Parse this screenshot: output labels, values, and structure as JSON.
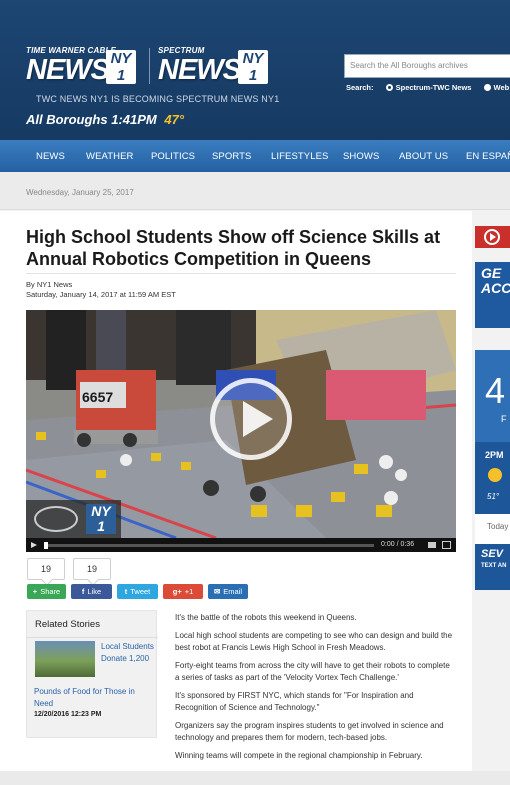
{
  "header": {
    "logo1": {
      "top": "TIME WARNER CABLE",
      "big": "NEWS",
      "badge": [
        "NY",
        "1"
      ]
    },
    "logo2": {
      "top": "SPECTRUM",
      "big": "NEWS",
      "badge": [
        "NY",
        "1"
      ]
    },
    "becoming": "TWC NEWS NY1 IS BECOMING SPECTRUM NEWS NY1",
    "borough": "All Boroughs",
    "time": "1:41PM",
    "temp": "47°",
    "search_placeholder": "Search the All Boroughs archives",
    "search_label": "Search:",
    "search_opt1": "Spectrum-TWC News",
    "search_opt2": "Web"
  },
  "nav": [
    "NEWS",
    "WEATHER",
    "POLITICS",
    "SPORTS",
    "LIFESTYLES",
    "SHOWS",
    "ABOUT US",
    "EN ESPAÑOL"
  ],
  "date": "Wednesday, January 25, 2017",
  "article": {
    "title": "High School Students Show off Science Skills at Annual Robotics Competition in Queens",
    "byline": "By NY1 News",
    "dateline": "Saturday, January 14, 2017 at 11:59 AM EST",
    "robot_number": "6657",
    "video_time": "0:00 / 0:36",
    "paragraphs": [
      "It's the battle of the robots this weekend in Queens.",
      "Local high school students are competing to see who can design and build the best robot at Francis Lewis High School in Fresh Meadows.",
      "Forty-eight  teams from across the city will have to get their robots to complete a series of tasks as part of the 'Velocity Vortex Tech Challenge.'",
      "It's sponsored by FIRST NYC, which stands for \"For Inspiration and Recognition of Science and Technology.\"",
      "Organizers say the program inspires students to get involved in science and technology and prepares them for modern, tech-based jobs.",
      "Winning teams will compete in the regional championship in February."
    ]
  },
  "share": {
    "count1": "19",
    "count2": "19",
    "buttons": [
      {
        "icon": "+",
        "label": "Share",
        "color": "#3aa757"
      },
      {
        "icon": "f",
        "label": "Like",
        "color": "#3b5998"
      },
      {
        "icon": "t",
        "label": "Tweet",
        "color": "#2ea7e0"
      },
      {
        "icon": "g+",
        "label": "+1",
        "color": "#dc4a38"
      },
      {
        "icon": "✉",
        "label": "Email",
        "color": "#2a6fb3"
      }
    ]
  },
  "related": {
    "heading": "Related Stories",
    "link": "Local Students Donate 1,200",
    "link2": "Pounds of Food for Those in Need",
    "date": "12/20/2016 12:23 PM"
  },
  "rail": {
    "ad_text": "GE ACC",
    "big_temp": "4",
    "f": "F",
    "hour": "2PM",
    "hour_temp": "51°",
    "today": "Today",
    "sev": "SEV",
    "sev_sub": "TEXT AN"
  }
}
